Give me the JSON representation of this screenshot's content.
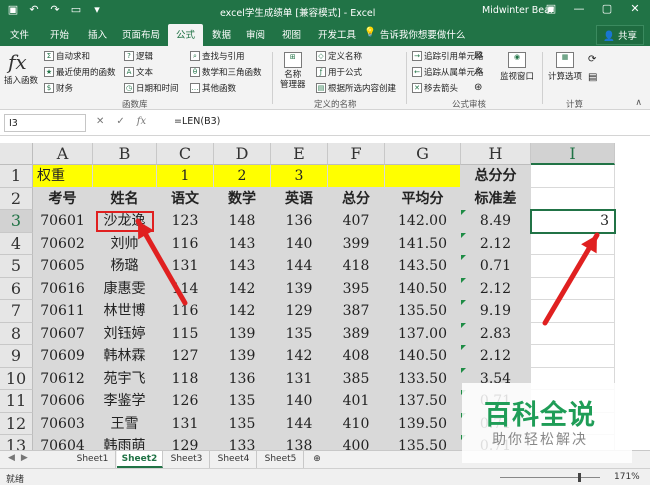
{
  "titlebar": {
    "title": "excel学生成绩单 [兼容模式] - Excel",
    "user": "Midwinter Bear",
    "qat": [
      "save-icon",
      "undo-icon",
      "redo-icon",
      "new-icon",
      "customize-icon"
    ]
  },
  "tabs": [
    "文件",
    "开始",
    "插入",
    "页面布局",
    "公式",
    "数据",
    "审阅",
    "视图",
    "开发工具",
    "福昕PDF"
  ],
  "active_tab": "公式",
  "tell_me": "告诉我你想要做什么",
  "share": "共享",
  "ribbon": {
    "insert_function": "插入函数",
    "library": {
      "col1": [
        "自动求和",
        "最近使用的函数",
        "财务"
      ],
      "col2": [
        "逻辑",
        "文本",
        "日期和时间"
      ],
      "col3": [
        "查找与引用",
        "数学和三角函数",
        "其他函数"
      ],
      "label": "函数库"
    },
    "names": {
      "manager": "名称\n管理器",
      "items": [
        "定义名称",
        "用于公式",
        "根据所选内容创建"
      ],
      "label": "定义的名称"
    },
    "audit": {
      "items": [
        "追踪引用单元格",
        "追踪从属单元格",
        "移去箭头"
      ],
      "watch": "监视窗口",
      "label": "公式审核"
    },
    "calc": {
      "options": "计算选项",
      "label": "计算"
    }
  },
  "formula_bar": {
    "name_box": "I3",
    "cancel": "✕",
    "enter": "✓",
    "fx": "fx",
    "formula": "=LEN(B3)"
  },
  "columns": [
    "A",
    "B",
    "C",
    "D",
    "E",
    "F",
    "G",
    "H",
    "I"
  ],
  "rows": [
    "1",
    "2",
    "3",
    "4",
    "5",
    "6",
    "7",
    "8",
    "9",
    "10",
    "11",
    "12",
    "13"
  ],
  "sheet": {
    "row1": {
      "A": "权重",
      "C": "1",
      "D": "2",
      "E": "3",
      "H": "总分分"
    },
    "headers": [
      "考号",
      "姓名",
      "语文",
      "数学",
      "英语",
      "总分",
      "平均分",
      "标准差"
    ],
    "records": [
      [
        "70601",
        "沙龙逸",
        "123",
        "148",
        "136",
        "407",
        "142.00",
        "8.49"
      ],
      [
        "70602",
        "刘帅",
        "116",
        "143",
        "140",
        "399",
        "141.50",
        "2.12"
      ],
      [
        "70605",
        "杨璐",
        "131",
        "143",
        "144",
        "418",
        "143.50",
        "0.71"
      ],
      [
        "70616",
        "康惠雯",
        "114",
        "142",
        "139",
        "395",
        "140.50",
        "2.12"
      ],
      [
        "70611",
        "林世博",
        "116",
        "142",
        "129",
        "387",
        "135.50",
        "9.19"
      ],
      [
        "70607",
        "刘钰婷",
        "115",
        "139",
        "135",
        "389",
        "137.00",
        "2.83"
      ],
      [
        "70609",
        "韩林霖",
        "127",
        "139",
        "142",
        "408",
        "140.50",
        "2.12"
      ],
      [
        "70612",
        "苑宇飞",
        "118",
        "136",
        "131",
        "385",
        "133.50",
        "3.54"
      ],
      [
        "70606",
        "李鉴学",
        "126",
        "135",
        "140",
        "401",
        "137.50",
        "0.71"
      ],
      [
        "70603",
        "王雪",
        "131",
        "135",
        "144",
        "410",
        "139.50",
        "0.71"
      ],
      [
        "70604",
        "韩雨萌",
        "129",
        "133",
        "138",
        "400",
        "135.50",
        "0.71"
      ]
    ],
    "I3": "3"
  },
  "sheet_tabs": [
    "Sheet1",
    "Sheet2",
    "Sheet3",
    "Sheet4",
    "Sheet5"
  ],
  "active_sheet": "Sheet2",
  "status": {
    "ready": "就绪",
    "zoom": "171%"
  },
  "watermark": {
    "title": "百科全说",
    "subtitle": "助你轻松解决"
  },
  "colors": {
    "excel_green": "#217346",
    "highlight_yellow": "#ffff00",
    "annotation_red": "#e02020",
    "watermark_green": "#1f9d57"
  }
}
